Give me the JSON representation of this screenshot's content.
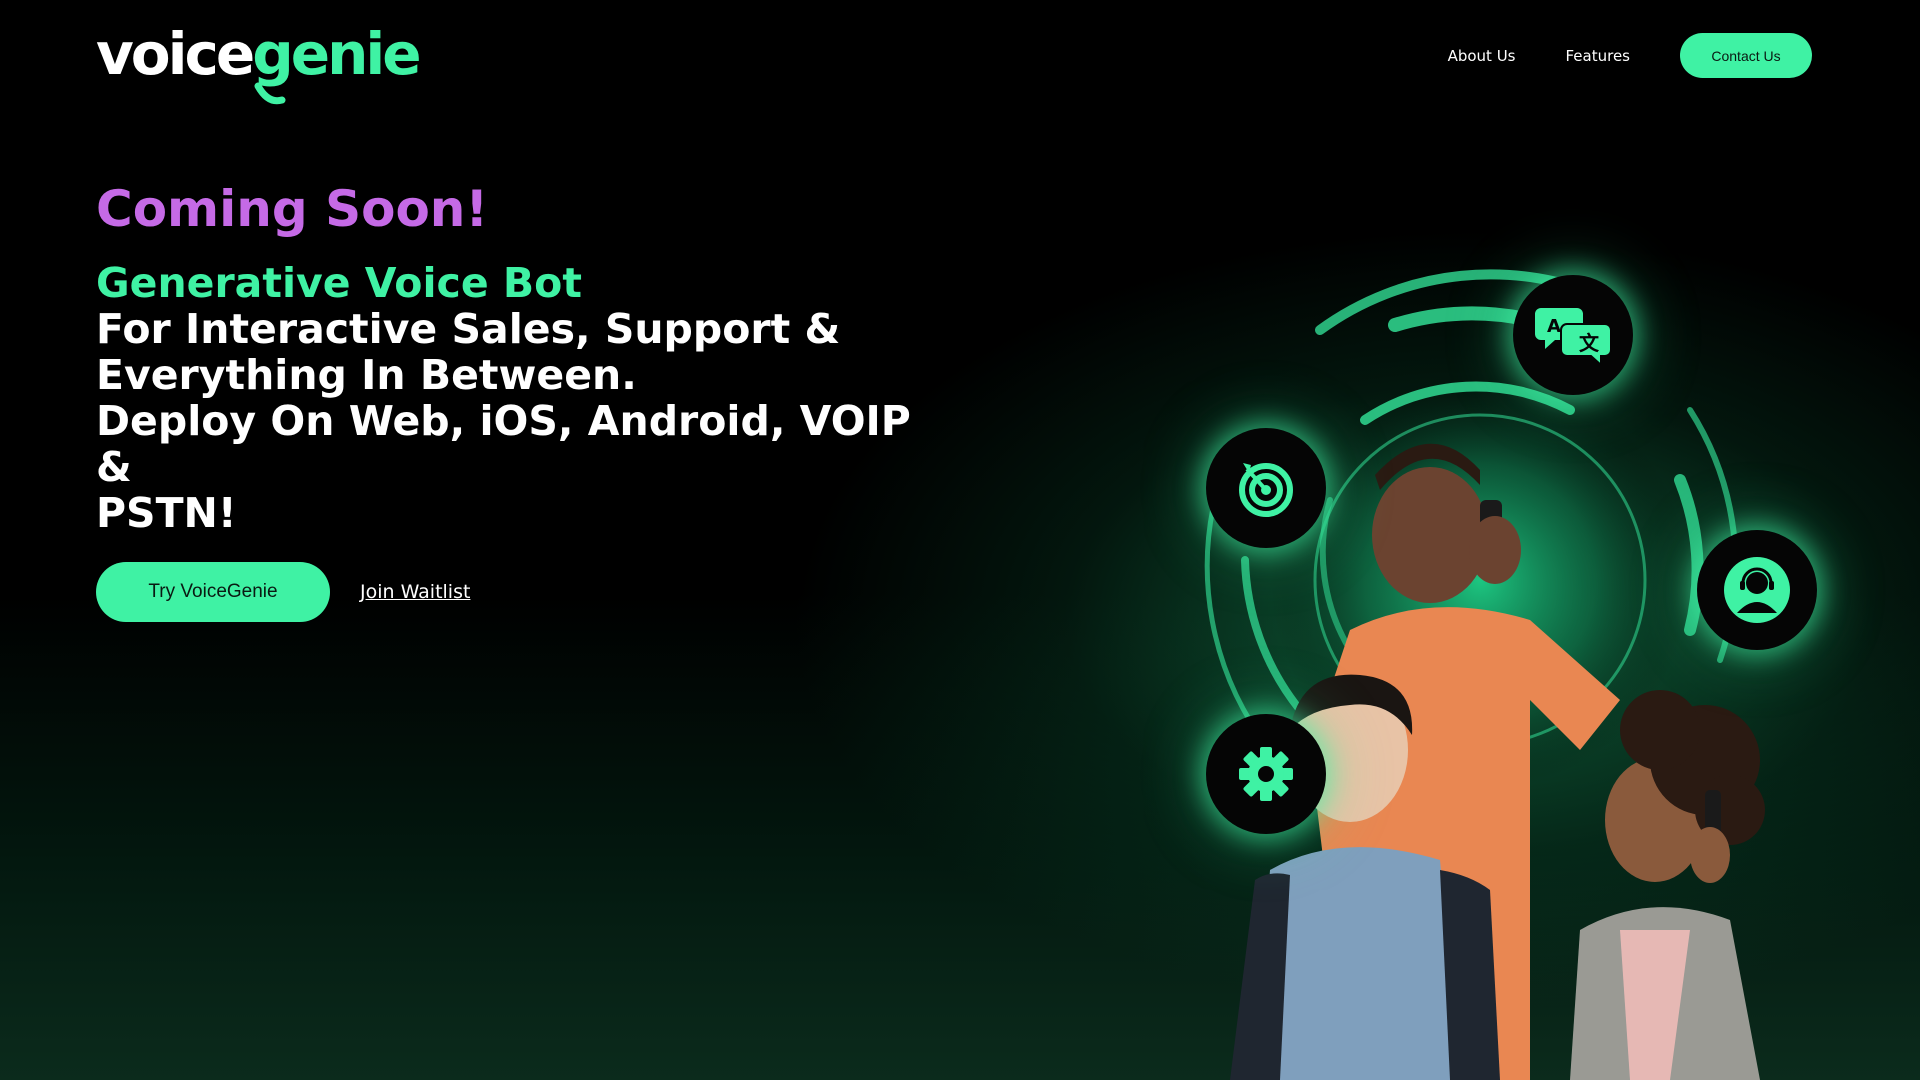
{
  "brand": {
    "logo_voice": "voice",
    "logo_genie": "genie"
  },
  "nav": {
    "about": "About Us",
    "features": "Features",
    "contact": "Contact Us"
  },
  "hero": {
    "coming_soon": "Coming Soon!",
    "headline_green": "Generative Voice Bot",
    "headline_line1": "For Interactive Sales, Support &",
    "headline_line2": "Everything In Between.",
    "headline_line3": "Deploy On Web, iOS, Android, VOIP &",
    "headline_line4": "PSTN!"
  },
  "cta": {
    "try_label": "Try VoiceGenie",
    "waitlist_label": "Join Waitlist"
  },
  "visual": {
    "feature_icons": [
      "translate-icon",
      "target-icon",
      "headset-agent-icon",
      "gear-icon"
    ]
  },
  "colors": {
    "accent_green": "#3ff2a4",
    "accent_purple": "#c56ae6",
    "background": "#000000"
  }
}
